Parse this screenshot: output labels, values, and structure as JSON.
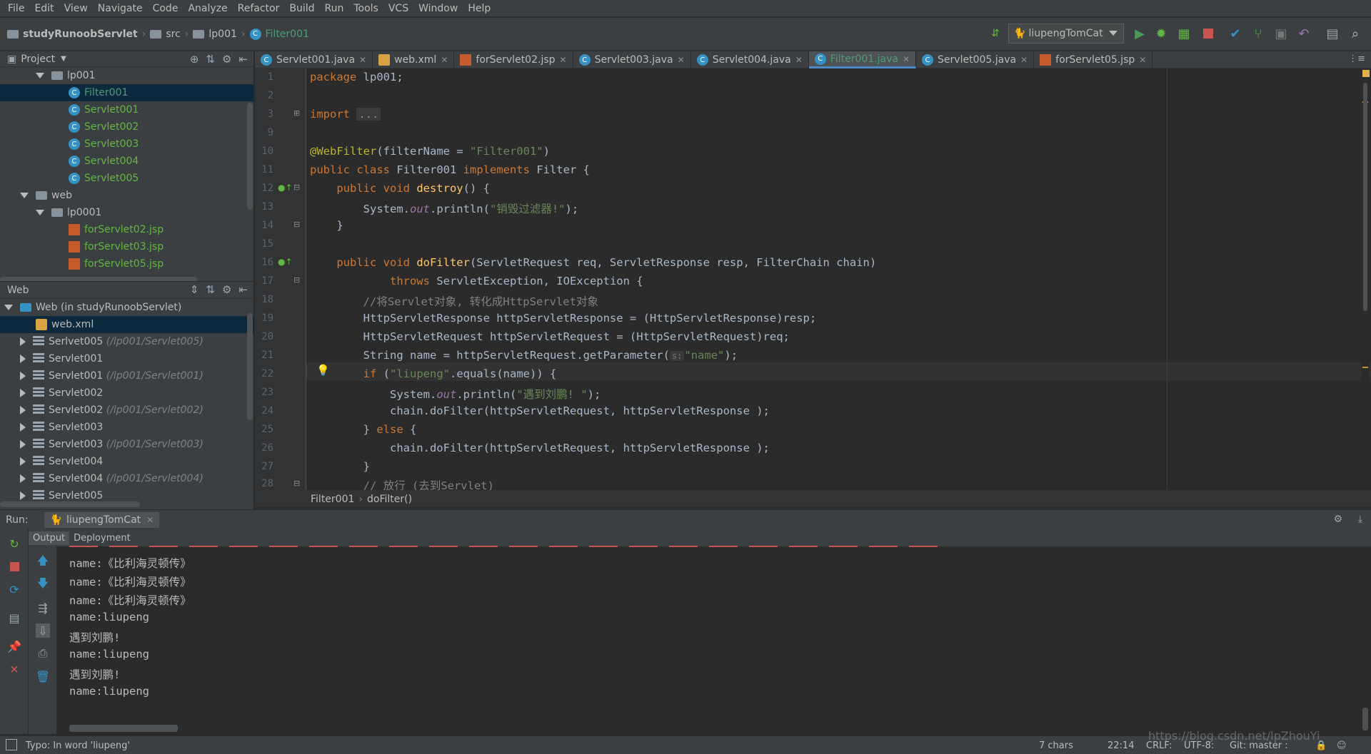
{
  "menu": [
    "File",
    "Edit",
    "View",
    "Navigate",
    "Code",
    "Analyze",
    "Refactor",
    "Build",
    "Run",
    "Tools",
    "VCS",
    "Window",
    "Help"
  ],
  "navbar": {
    "project": "studyRunoobServlet",
    "src": "src",
    "package": "lp001",
    "file": "Filter001",
    "run_config": "liupengTomCat"
  },
  "project_panel": {
    "title": "Project",
    "rows": [
      {
        "label": "lp001",
        "type": "package"
      },
      {
        "label": "Filter001",
        "type": "class"
      },
      {
        "label": "Servlet001",
        "type": "class"
      },
      {
        "label": "Servlet002",
        "type": "class"
      },
      {
        "label": "Servlet003",
        "type": "class"
      },
      {
        "label": "Servlet004",
        "type": "class"
      },
      {
        "label": "Servlet005",
        "type": "class"
      },
      {
        "label": "web",
        "type": "folder"
      },
      {
        "label": "lp0001",
        "type": "folder"
      },
      {
        "label": "forServlet02.jsp",
        "type": "jsp"
      },
      {
        "label": "forServlet03.jsp",
        "type": "jsp"
      },
      {
        "label": "forServlet05.jsp",
        "type": "jsp"
      }
    ]
  },
  "web_panel": {
    "title": "Web",
    "root": "Web (in studyRunoobServlet)",
    "rows": [
      {
        "label": "web.xml",
        "path": ""
      },
      {
        "label": "Serlvet005",
        "path": "(/lp001/Servlet005)"
      },
      {
        "label": "Servlet001",
        "path": ""
      },
      {
        "label": "Servlet001",
        "path": "(/lp001/Servlet001)"
      },
      {
        "label": "Servlet002",
        "path": ""
      },
      {
        "label": "Servlet002",
        "path": "(/lp001/Servlet002)"
      },
      {
        "label": "Servlet003",
        "path": ""
      },
      {
        "label": "Servlet003",
        "path": "(/lp001/Servlet003)"
      },
      {
        "label": "Servlet004",
        "path": ""
      },
      {
        "label": "Servlet004",
        "path": "(/lp001/Servlet004)"
      },
      {
        "label": "Servlet005",
        "path": ""
      }
    ]
  },
  "editor_tabs": [
    {
      "label": "Servlet001.java",
      "icon": "class"
    },
    {
      "label": "web.xml",
      "icon": "xml"
    },
    {
      "label": "forServlet02.jsp",
      "icon": "jsp"
    },
    {
      "label": "Servlet003.java",
      "icon": "class"
    },
    {
      "label": "Servlet004.java",
      "icon": "class"
    },
    {
      "label": "Filter001.java",
      "icon": "class",
      "active": true
    },
    {
      "label": "Servlet005.java",
      "icon": "class"
    },
    {
      "label": "forServlet05.jsp",
      "icon": "jsp"
    }
  ],
  "line_numbers": [
    "1",
    "2",
    "3",
    "9",
    "10",
    "11",
    "12",
    "13",
    "14",
    "15",
    "16",
    "17",
    "18",
    "19",
    "20",
    "21",
    "22",
    "23",
    "24",
    "25",
    "26",
    "27",
    "28"
  ],
  "code": {
    "l1_kw": "package",
    "l1_rest": " lp001;",
    "l3_kw": "import",
    "l3_fold": "...",
    "l10_ann": "@WebFilter",
    "l10_a": "(filterName = ",
    "l10_str": "\"Filter001\"",
    "l10_b": ")",
    "l11_a": "public class ",
    "l11_cls": "Filter001 ",
    "l11_b": "implements ",
    "l11_c": "Filter",
    "l11_d": " {",
    "l12_kw": "    public void ",
    "l12_m": "destroy",
    "l12_r": "() {",
    "l13_a": "        System.",
    "l13_f": "out",
    "l13_b": ".println(",
    "l13_s": "\"销毁过滤器!\"",
    "l13_c": ");",
    "l14": "    }",
    "l16_kw": "    public void ",
    "l16_m": "doFilter",
    "l16_r": "(ServletRequest req, ServletResponse resp, FilterChain chain)",
    "l17_kw": "            throws ",
    "l17_r": "ServletException, IOException {",
    "l18": "        //将Servlet对象, 转化成HttpServlet对象",
    "l19": "        HttpServletResponse httpServletResponse = (HttpServletResponse)resp;",
    "l20": "        HttpServletRequest httpServletRequest = (HttpServletRequest)req;",
    "l21_a": "        String name = httpServletRequest.getParameter(",
    "l21_hint": "s:",
    "l21_s": "\"name\"",
    "l21_b": ");",
    "l22_kw": "        if ",
    "l22_a": "(",
    "l22_s": "\"liupeng\"",
    "l22_b": ".equals(name)) {",
    "l23_a": "            System.",
    "l23_f": "out",
    "l23_b": ".println(",
    "l23_s": "\"遇到刘鹏! \"",
    "l23_c": ");",
    "l24": "            chain.doFilter(httpServletRequest, httpServletResponse );",
    "l25_a": "        } ",
    "l25_kw": "else",
    "l25_b": " {",
    "l26": "            chain.doFilter(httpServletRequest, httpServletResponse );",
    "l27": "        }",
    "l28": "        // 放行 (去到Servlet)"
  },
  "editor_breadcrumb": {
    "cls": "Filter001",
    "method": "doFilter()"
  },
  "run_panel": {
    "label": "Run:",
    "tab": "liupengTomCat",
    "subtabs": [
      "Output",
      "Deployment"
    ],
    "output": [
      "name:《比利海灵顿传》",
      "name:《比利海灵顿传》",
      "name:《比利海灵顿传》",
      "name:liupeng",
      "遇到刘鹏!",
      "name:liupeng",
      "遇到刘鹏!",
      "name:liupeng"
    ]
  },
  "statusbar": {
    "message": "Typo: In word 'liupeng'",
    "chars": "7 chars",
    "position": "22:14",
    "line_sep": "CRLF:",
    "encoding": "UTF-8:",
    "git": "Git: master :"
  },
  "watermark": "https://blog.csdn.net/lpZhouYi",
  "colors": {
    "keyword": "#cc7832",
    "string": "#6a8759",
    "annotation": "#bbb529",
    "selection": "#0d293e",
    "active_tab_text": "#4e9a79"
  }
}
